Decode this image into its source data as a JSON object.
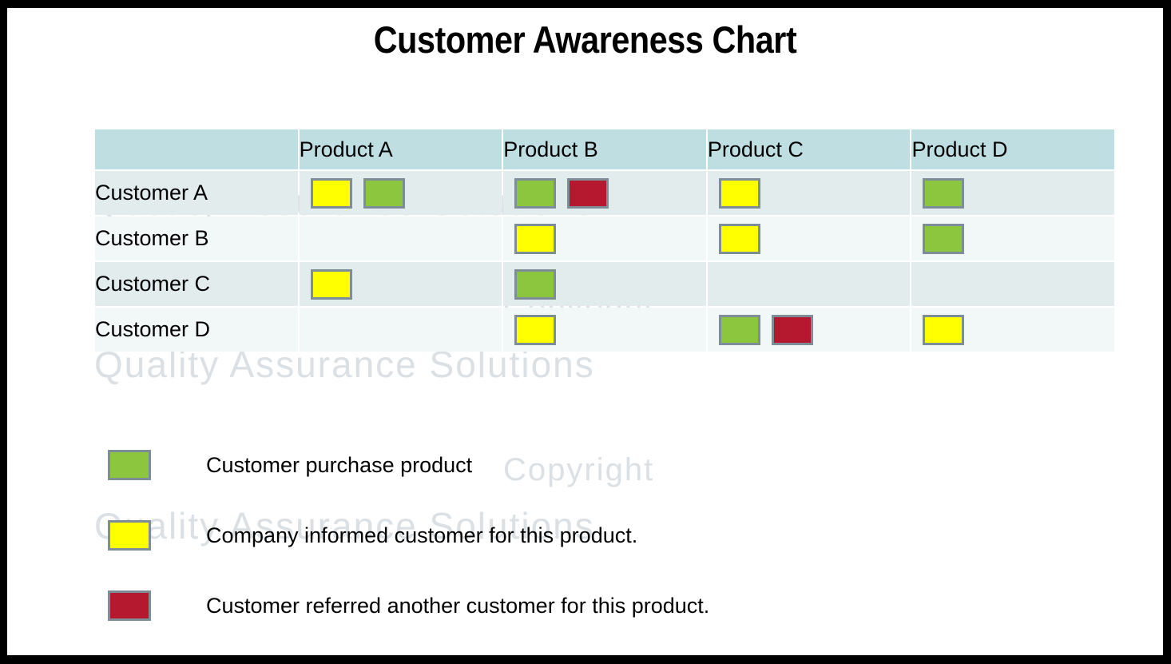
{
  "page": {
    "title": "Customer Awareness Chart",
    "frame_color": "#000000",
    "background": "#ffffff"
  },
  "watermark": {
    "line1": "Copyright",
    "line2": "Quality Assurance Solutions"
  },
  "chart_data": {
    "type": "table",
    "title": "Customer Awareness Chart",
    "xlabel": "",
    "ylabel": "",
    "columns": [
      "",
      "Product A",
      "Product B",
      "Product C",
      "Product D"
    ],
    "categories": [
      "Customer A",
      "Customer B",
      "Customer C",
      "Customer D"
    ],
    "series": [
      {
        "name": "Product A",
        "values": [
          [
            "yellow",
            "green"
          ],
          [],
          [
            "yellow"
          ],
          []
        ]
      },
      {
        "name": "Product B",
        "values": [
          [
            "green",
            "red"
          ],
          [
            "yellow"
          ],
          [
            "green"
          ],
          [
            "yellow"
          ]
        ]
      },
      {
        "name": "Product C",
        "values": [
          [
            "yellow"
          ],
          [
            "yellow"
          ],
          [],
          [
            "green",
            "red"
          ]
        ]
      },
      {
        "name": "Product D",
        "values": [
          [
            "green"
          ],
          [
            "green"
          ],
          [],
          [
            "yellow"
          ]
        ]
      }
    ],
    "legend_position": "below",
    "grid": true,
    "marker_colors": {
      "green": "#8CC63E",
      "yellow": "#FFFF00",
      "red": "#B5192F",
      "border": "#7E8E99"
    },
    "table_colors": {
      "header_bg": "#BEDEE2",
      "row_odd_bg": "#E2ECED",
      "row_even_bg": "#F2F7F8"
    }
  },
  "table": {
    "headers": {
      "corner": "",
      "col1": "Product A",
      "col2": "Product B",
      "col3": "Product C",
      "col4": "Product D"
    },
    "rows": [
      {
        "label": "Customer A",
        "cells": [
          [
            "yellow",
            "green"
          ],
          [
            "green",
            "red"
          ],
          [
            "yellow"
          ],
          [
            "green"
          ]
        ]
      },
      {
        "label": "Customer B",
        "cells": [
          [],
          [
            "yellow"
          ],
          [
            "yellow"
          ],
          [
            "green"
          ]
        ]
      },
      {
        "label": "Customer C",
        "cells": [
          [
            "yellow"
          ],
          [
            "green"
          ],
          [],
          []
        ]
      },
      {
        "label": "Customer D",
        "cells": [
          [],
          [
            "yellow"
          ],
          [
            "green",
            "red"
          ],
          [
            "yellow"
          ]
        ]
      }
    ]
  },
  "legend": {
    "items": [
      {
        "color": "green",
        "label": "Customer purchase product"
      },
      {
        "color": "yellow",
        "label": "Company informed customer for this product."
      },
      {
        "color": "red",
        "label": "Customer referred another customer for this product."
      }
    ]
  }
}
